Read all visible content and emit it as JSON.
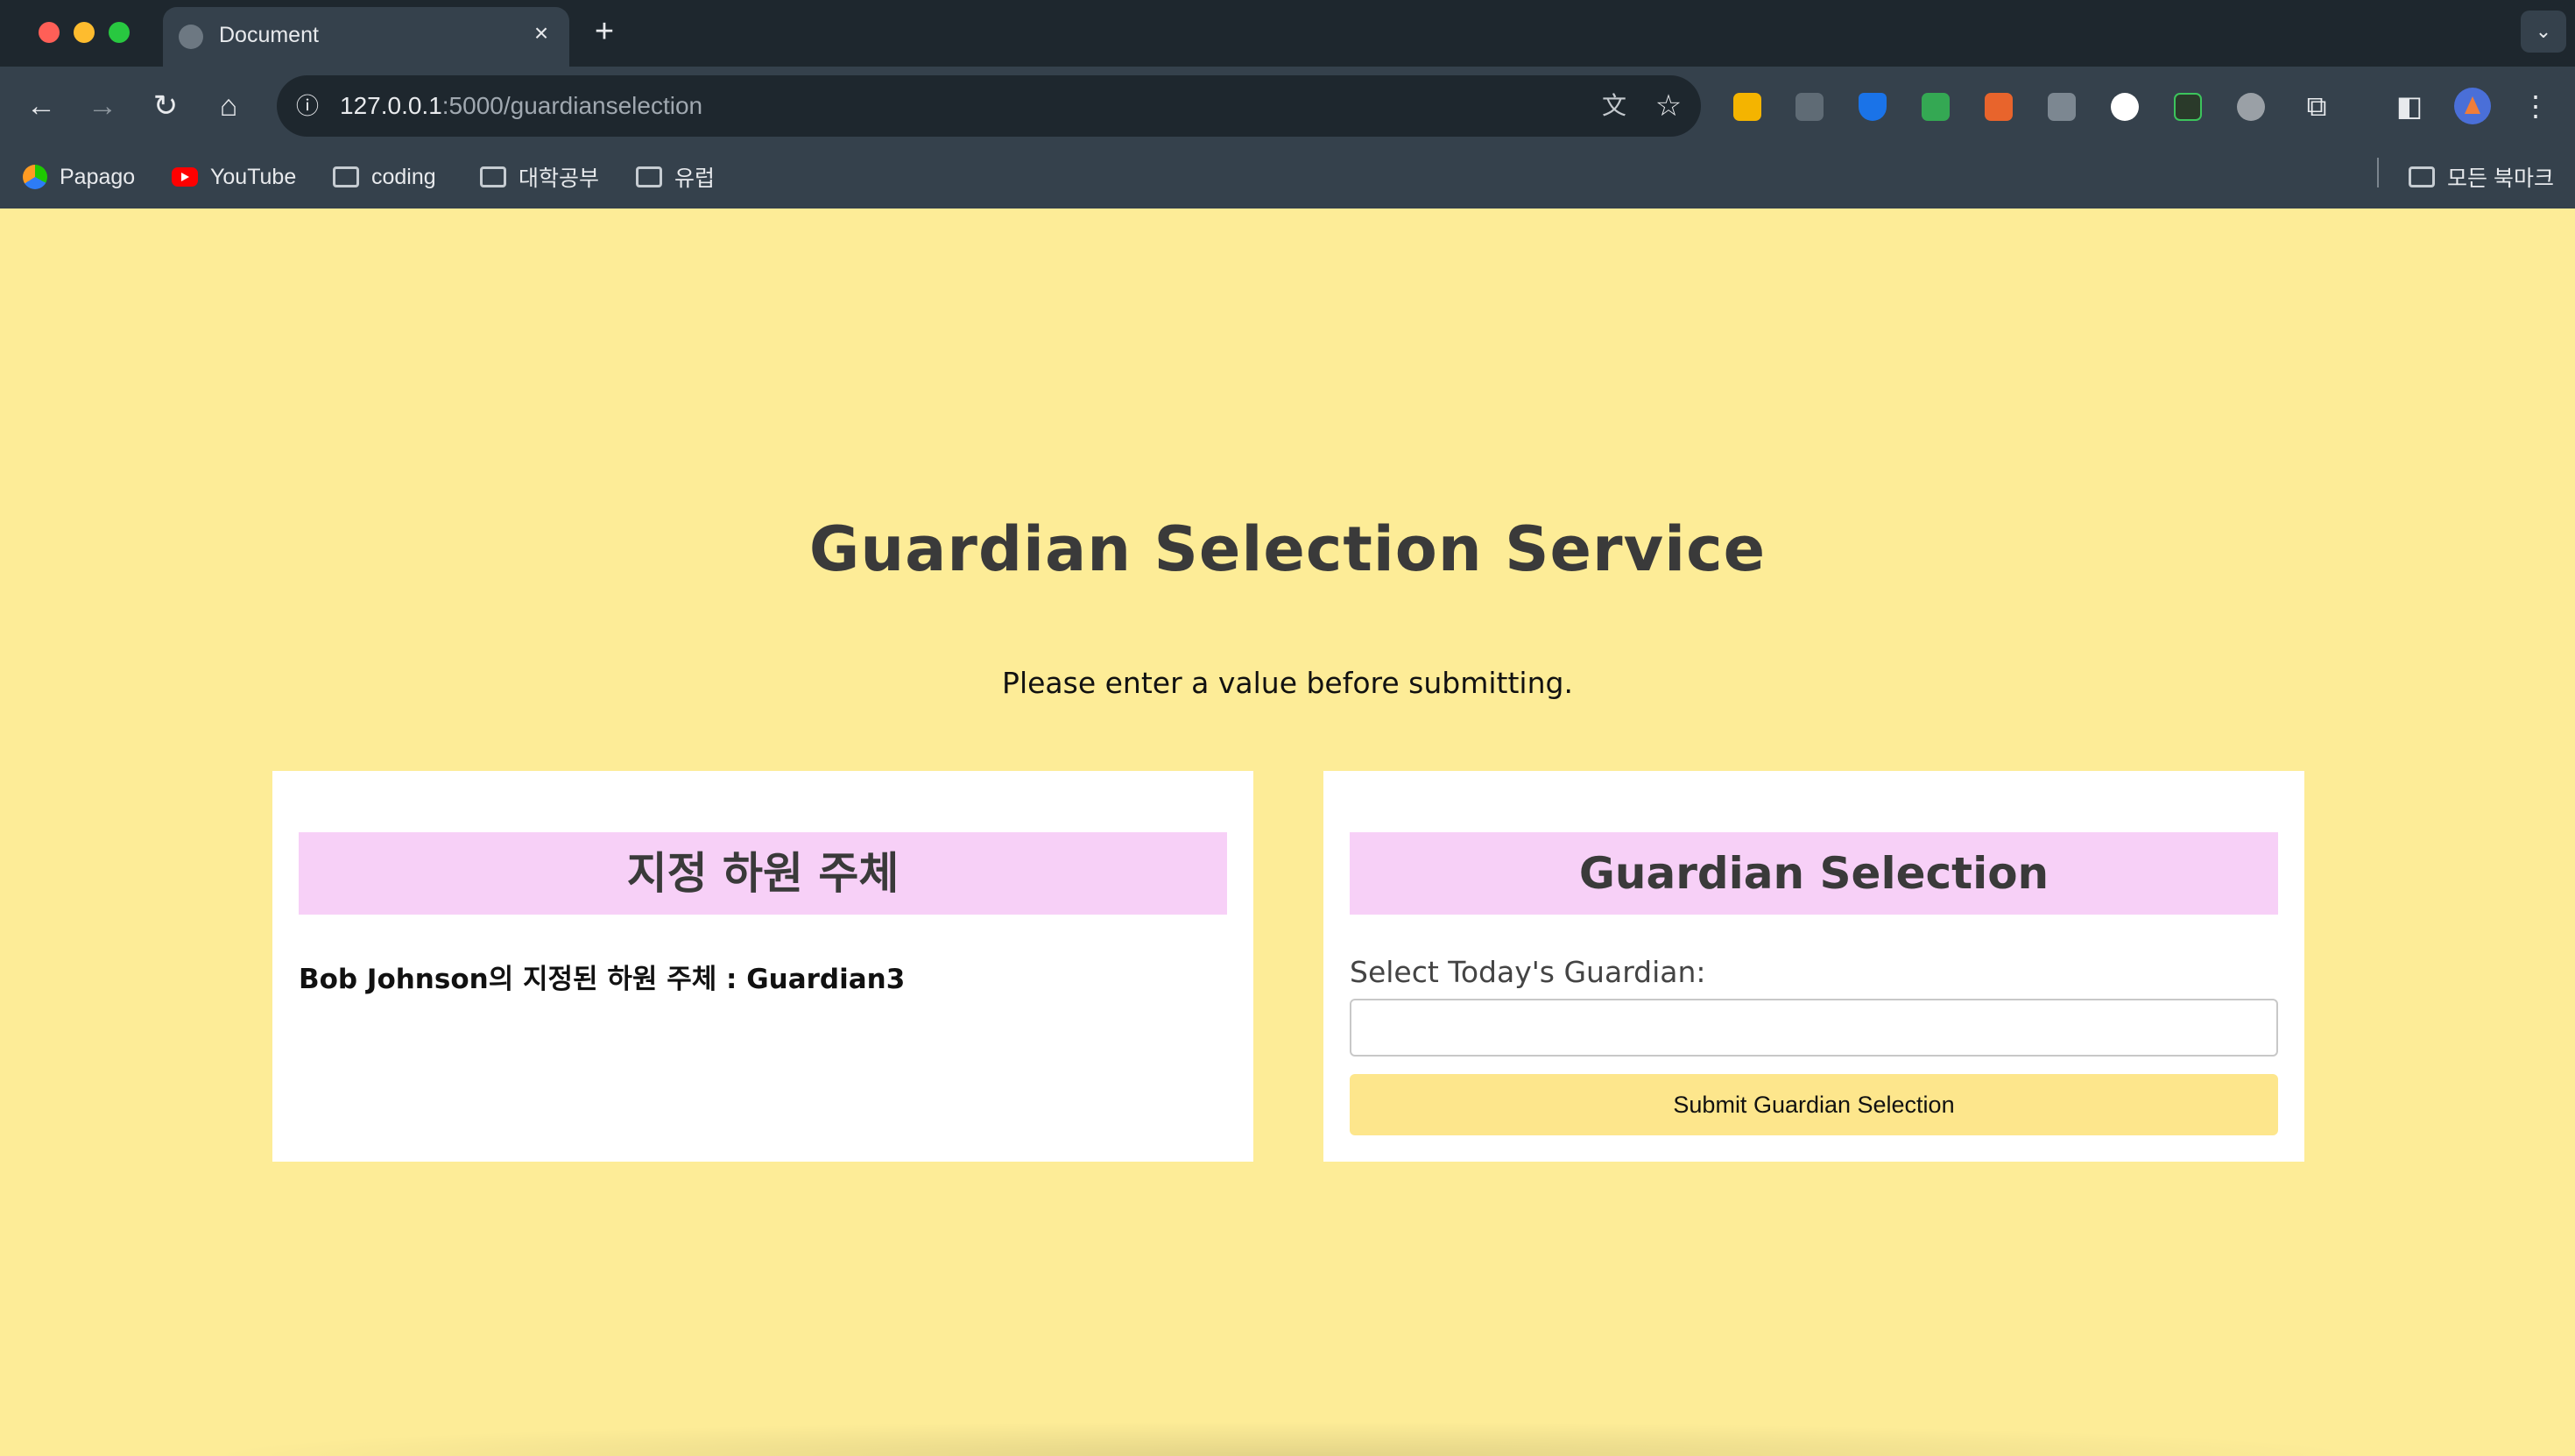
{
  "browser": {
    "tab_title": "Document",
    "tab_close": "×",
    "new_tab": "+",
    "url_host": "127.0.0.1",
    "url_path": ":5000/guardianselection",
    "bookmarks": [
      {
        "label": "Papago",
        "icon": "papago-icon"
      },
      {
        "label": "YouTube",
        "icon": "youtube-icon"
      },
      {
        "label": "coding",
        "icon": "folder-icon"
      },
      {
        "label": "대학공부",
        "icon": "folder-icon"
      },
      {
        "label": "유럽",
        "icon": "folder-icon"
      }
    ],
    "all_bookmarks": "모든 북마크",
    "extension_colors": [
      "#f4b400",
      "#5f6b75",
      "#1a73e8",
      "#34a853",
      "#e8642c",
      "#7c8791",
      "#ffffff",
      "#2a3a2a",
      "#9aa0a6"
    ]
  },
  "page": {
    "title": "Guardian Selection Service",
    "message": "Please enter a value before submitting.",
    "left_card": {
      "header": "지정 하원 주체",
      "text": "Bob Johnson의 지정된 하원 주체 : Guardian3"
    },
    "right_card": {
      "header": "Guardian Selection",
      "field_label": "Select Today's Guardian:",
      "field_value": "",
      "submit_label": "Submit Guardian Selection"
    }
  },
  "colors": {
    "page_bg": "#fdec97",
    "card_header_bg": "#f7d0f7",
    "button_bg": "#fde68c"
  }
}
